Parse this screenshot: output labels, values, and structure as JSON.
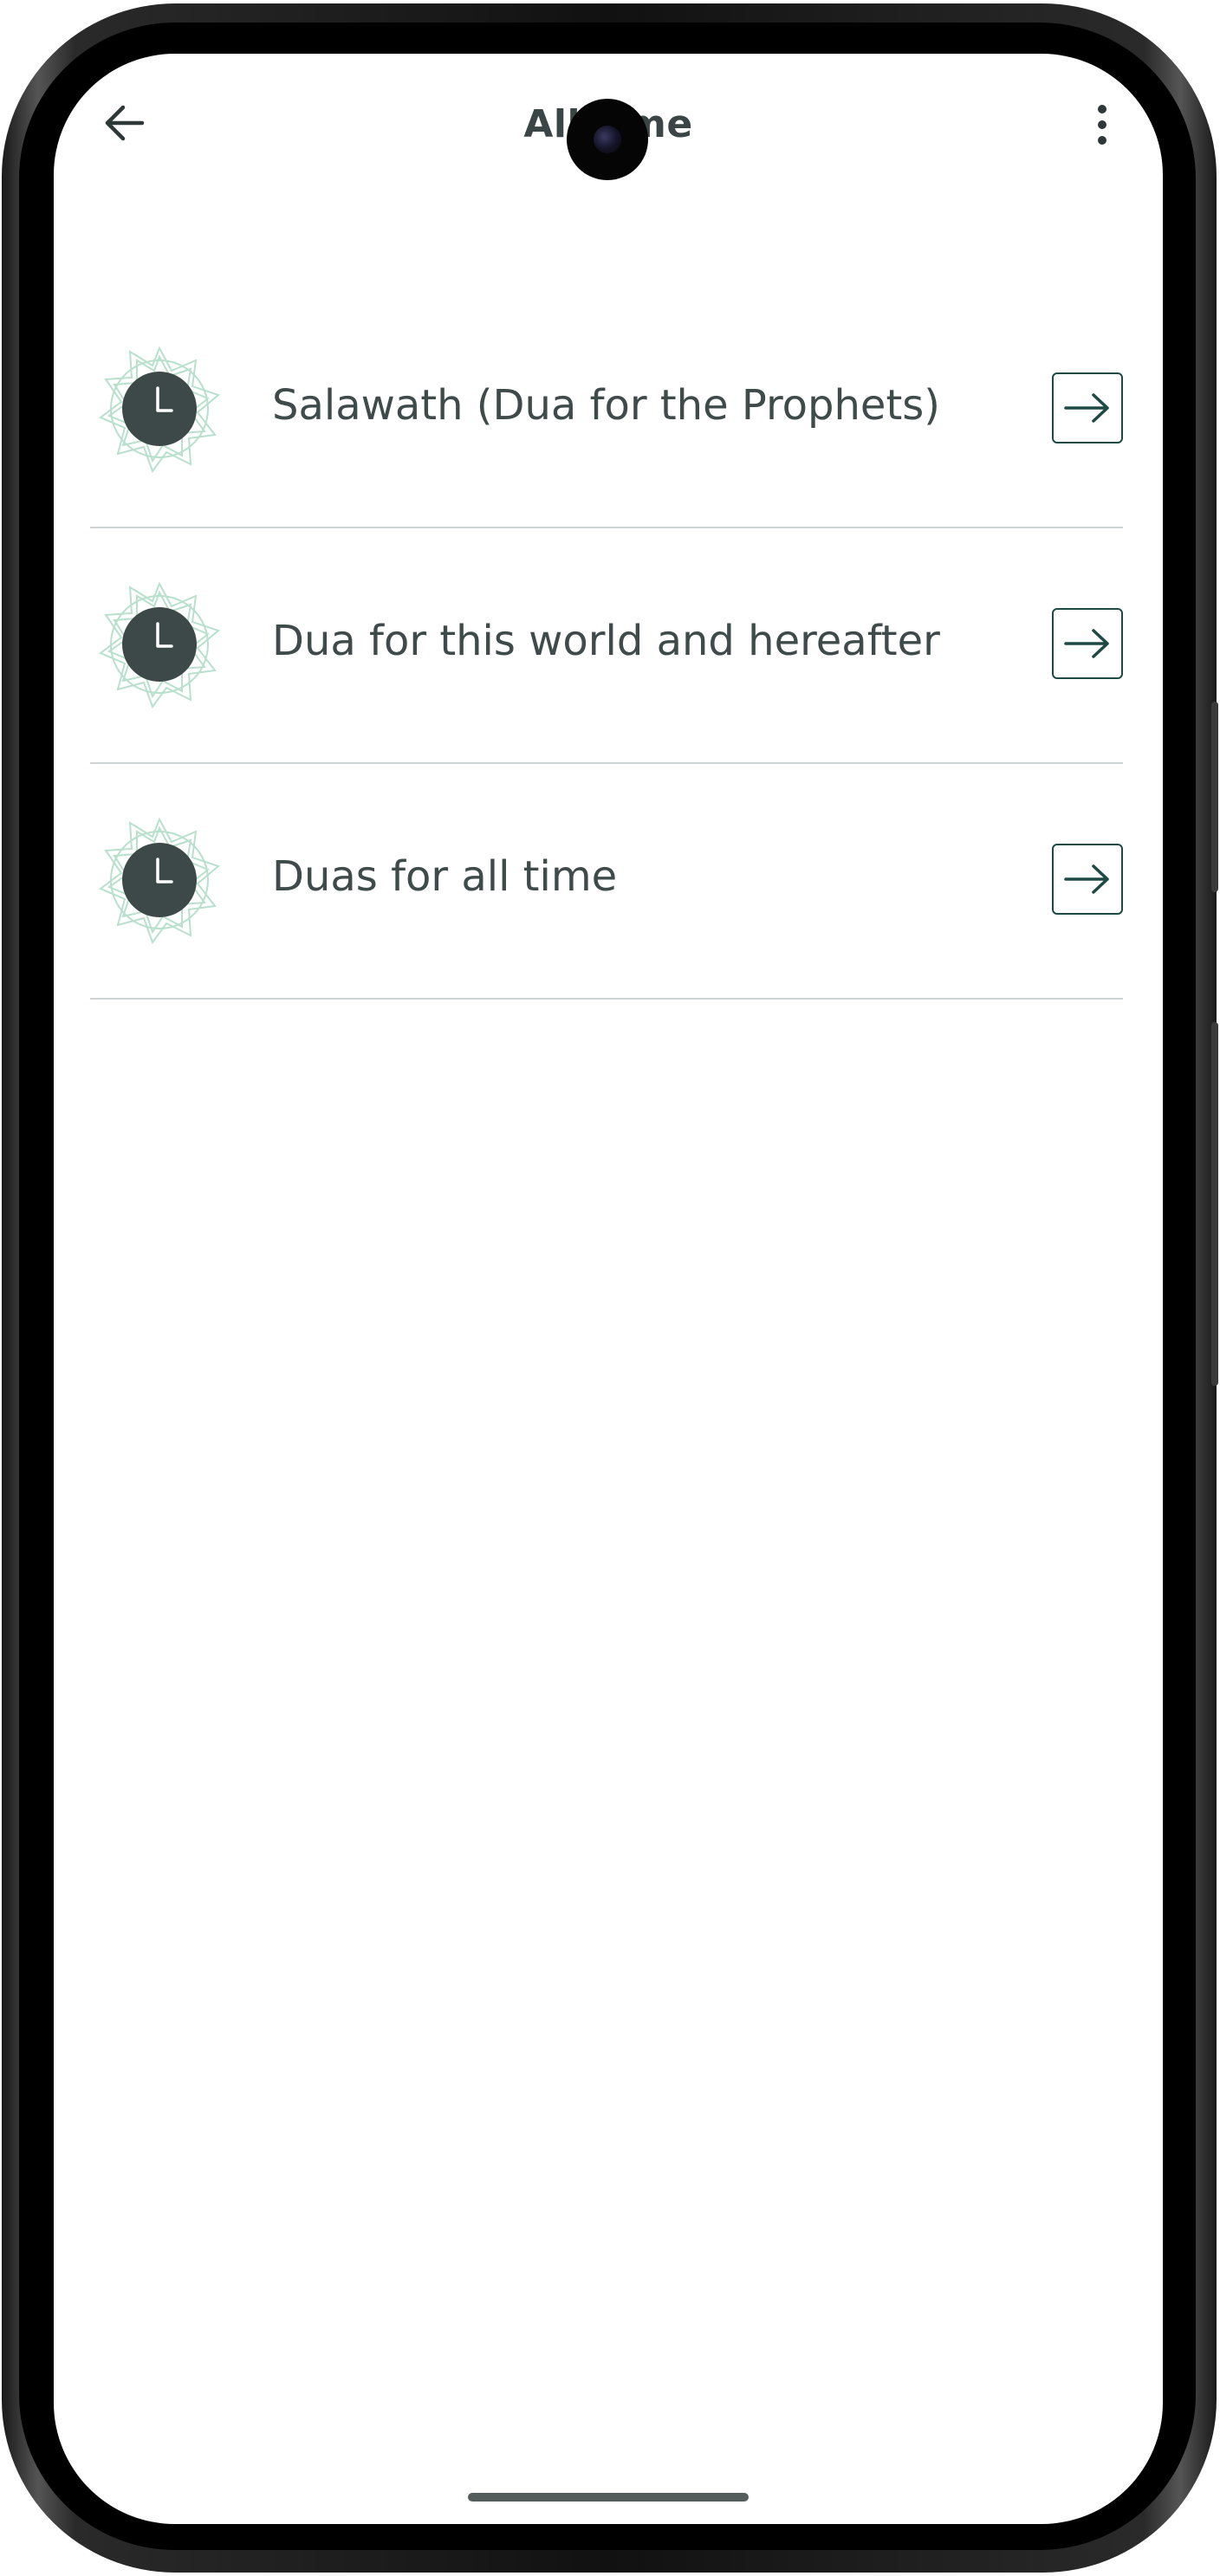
{
  "header": {
    "title": "All time",
    "back_icon": "arrow-left-icon",
    "menu_icon": "more-vertical-icon"
  },
  "items": [
    {
      "label": "Salawath (Dua for the Prophets)",
      "icon": "clock-icon",
      "action_icon": "arrow-right-icon"
    },
    {
      "label": "Dua for this world and hereafter",
      "icon": "clock-icon",
      "action_icon": "arrow-right-icon"
    },
    {
      "label": "Duas for all time",
      "icon": "clock-icon",
      "action_icon": "arrow-right-icon"
    }
  ],
  "colors": {
    "text": "#3f4a4a",
    "icon_dark": "#3d4848",
    "accent": "#1e4a44",
    "ornament": "#b8e0cc",
    "divider": "#cfd3d3"
  }
}
